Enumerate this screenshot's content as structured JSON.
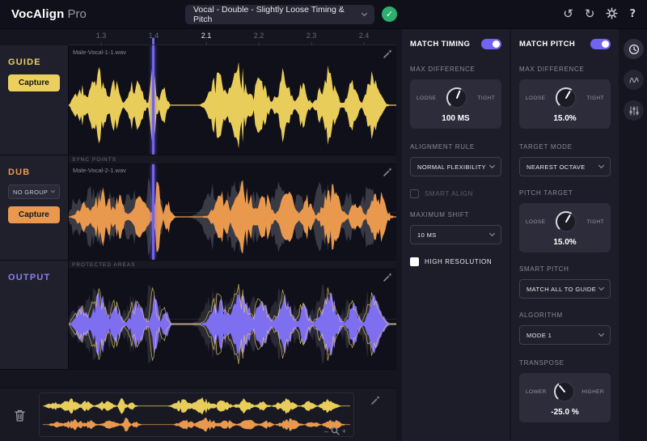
{
  "colors": {
    "accent": "#7164f0",
    "guide": "#e9cd5a",
    "dub": "#e8994e",
    "output": "#7e6ef0",
    "success": "#2eaf6f"
  },
  "header": {
    "app_name": "VocAlign",
    "app_edition": "Pro",
    "preset_value": "Vocal - Double - Slightly Loose Timing & Pitch",
    "help_label": "?"
  },
  "timeline": {
    "ticks": [
      "1.3",
      "1.4",
      "2.1",
      "2.2",
      "2.3",
      "2.4"
    ]
  },
  "tracks": {
    "guide": {
      "name": "GUIDE",
      "file": "Male-Vocal-1-1.wav",
      "capture": "Capture"
    },
    "dub": {
      "name": "DUB",
      "file": "Male-Vocal-2-1.wav",
      "group": "NO GROUP",
      "capture": "Capture",
      "strip": "SYNC POINTS"
    },
    "output": {
      "name": "OUTPUT",
      "strip": "PROTECTED AREAS"
    }
  },
  "timing_panel": {
    "title": "MATCH TIMING",
    "enabled": true,
    "max_difference": {
      "label": "MAX DIFFERENCE",
      "left": "LOOSE",
      "right": "TIGHT",
      "value": "100 MS"
    },
    "alignment_rule": {
      "label": "ALIGNMENT RULE",
      "value": "NORMAL FLEXIBILITY"
    },
    "smart_align": {
      "label": "SMART ALIGN",
      "checked": false
    },
    "maximum_shift": {
      "label": "MAXIMUM SHIFT",
      "value": "10 MS"
    },
    "high_resolution": {
      "label": "HIGH RESOLUTION",
      "checked": true
    }
  },
  "pitch_panel": {
    "title": "MATCH PITCH",
    "enabled": true,
    "max_difference": {
      "label": "MAX DIFFERENCE",
      "left": "LOOSE",
      "right": "TIGHT",
      "value": "15.0%"
    },
    "target_mode": {
      "label": "TARGET MODE",
      "value": "NEAREST OCTAVE"
    },
    "pitch_target": {
      "label": "PITCH TARGET",
      "left": "LOOSE",
      "right": "TIGHT",
      "value": "15.0%"
    },
    "smart_pitch": {
      "label": "SMART PITCH",
      "value": "MATCH ALL TO GUIDE"
    },
    "algorithm": {
      "label": "ALGORITHM",
      "value": "MODE 1"
    },
    "transpose": {
      "label": "TRANSPOSE",
      "left": "LOWER",
      "right": "HIGHER",
      "value": "-25.0 %"
    }
  }
}
